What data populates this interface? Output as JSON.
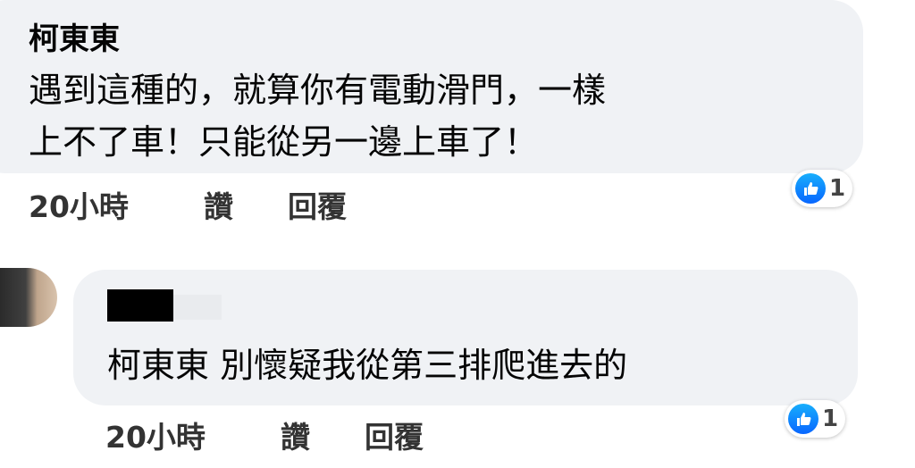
{
  "comments": [
    {
      "author": "柯東東",
      "text_line1": "遇到這種的，就算你有電動滑門，一樣",
      "text_line2": "上不了車！只能從另一邊上車了！",
      "time": "20小時",
      "like_label": "讚",
      "reply_label": "回覆",
      "reaction_count": "1"
    },
    {
      "author": "",
      "text_line1": "柯東東 別懷疑我從第三排爬進去的",
      "time": "20小時",
      "like_label": "讚",
      "reply_label": "回覆",
      "reaction_count": "1"
    }
  ],
  "colors": {
    "bubble": "#f0f2f5",
    "like_blue": "#0866ff"
  },
  "icons": {
    "reaction": "thumbs-up-icon"
  }
}
